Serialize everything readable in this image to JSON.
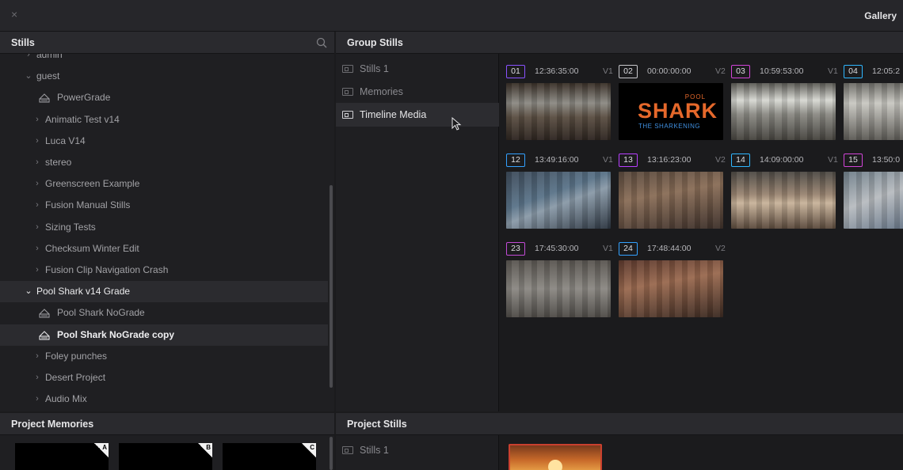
{
  "window": {
    "title": "Gallery",
    "close_glyph": "×"
  },
  "stills_panel": {
    "header": "Stills",
    "search_icon": "search-icon",
    "items": [
      {
        "label": "admin",
        "chevron": "›",
        "type": "folder"
      },
      {
        "label": "guest",
        "chevron": "⌄",
        "type": "folder"
      },
      {
        "label": "PowerGrade",
        "chevron": "",
        "type": "album"
      },
      {
        "label": "Animatic Test v14",
        "chevron": "›",
        "type": "folder"
      },
      {
        "label": "Luca V14",
        "chevron": "›",
        "type": "folder"
      },
      {
        "label": "stereo",
        "chevron": "›",
        "type": "folder"
      },
      {
        "label": "Greenscreen Example",
        "chevron": "›",
        "type": "folder"
      },
      {
        "label": "Fusion Manual Stills",
        "chevron": "›",
        "type": "folder"
      },
      {
        "label": "Sizing Tests",
        "chevron": "›",
        "type": "folder"
      },
      {
        "label": "Checksum Winter Edit",
        "chevron": "›",
        "type": "folder"
      },
      {
        "label": "Fusion Clip Navigation Crash",
        "chevron": "›",
        "type": "folder"
      },
      {
        "label": "Pool Shark v14 Grade",
        "chevron": "⌄",
        "type": "folder"
      },
      {
        "label": "Pool Shark NoGrade",
        "chevron": "",
        "type": "album"
      },
      {
        "label": "Pool Shark NoGrade copy",
        "chevron": "",
        "type": "album"
      },
      {
        "label": "Foley punches",
        "chevron": "›",
        "type": "folder"
      },
      {
        "label": "Desert Project",
        "chevron": "›",
        "type": "folder"
      },
      {
        "label": "Audio Mix",
        "chevron": "›",
        "type": "folder"
      }
    ]
  },
  "group_stills": {
    "header": "Group Stills",
    "items": [
      "Stills 1",
      "Memories",
      "Timeline Media"
    ],
    "active": "Timeline Media"
  },
  "stills": [
    {
      "num": "01",
      "tc": "12:36:35:00",
      "ver": "V1",
      "color": "#8a52ff"
    },
    {
      "num": "02",
      "tc": "00:00:00:00",
      "ver": "V2",
      "color": "#c9c9cd"
    },
    {
      "num": "03",
      "tc": "10:59:53:00",
      "ver": "V1",
      "color": "#d244d8"
    },
    {
      "num": "04",
      "tc": "12:05:2",
      "ver": "",
      "color": "#2fb7ff"
    },
    {
      "num": "12",
      "tc": "13:49:16:00",
      "ver": "V1",
      "color": "#33a1ff"
    },
    {
      "num": "13",
      "tc": "13:16:23:00",
      "ver": "V2",
      "color": "#b83fff"
    },
    {
      "num": "14",
      "tc": "14:09:00:00",
      "ver": "V1",
      "color": "#2fb7ff"
    },
    {
      "num": "15",
      "tc": "13:50:0",
      "ver": "",
      "color": "#d244d8"
    },
    {
      "num": "23",
      "tc": "17:45:30:00",
      "ver": "V1",
      "color": "#c24bd6"
    },
    {
      "num": "24",
      "tc": "17:48:44:00",
      "ver": "V2",
      "color": "#33a1ff"
    }
  ],
  "shark_title": {
    "pool": "POOL",
    "shark": "SHARK",
    "sub": "THE SHARKENING"
  },
  "project_memories": {
    "header": "Project Memories",
    "slots": [
      "A",
      "B",
      "C"
    ]
  },
  "project_stills": {
    "header": "Project Stills",
    "items": [
      "Stills 1"
    ]
  }
}
